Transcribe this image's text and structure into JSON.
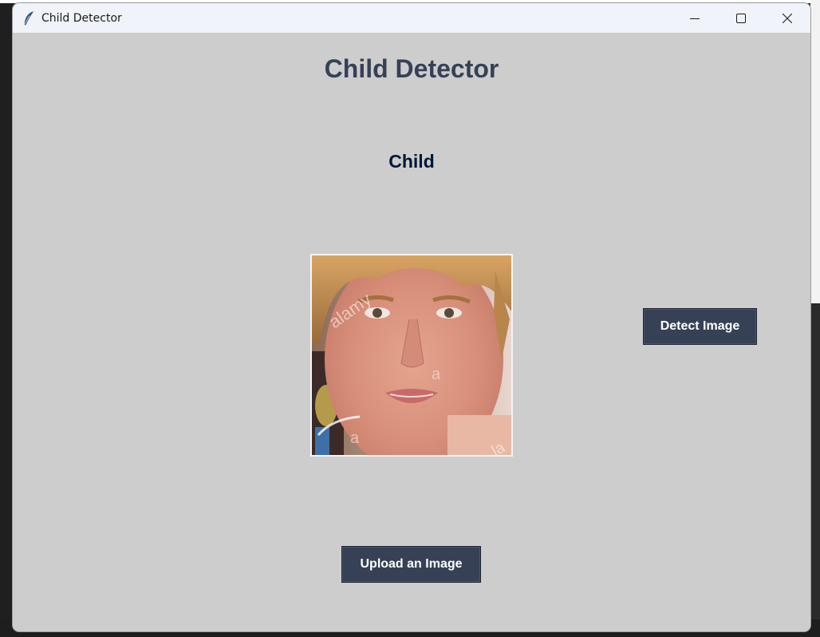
{
  "window": {
    "title": "Child Detector",
    "app_icon": "feather-icon",
    "controls": [
      "minimize-icon",
      "maximize-icon",
      "close-icon"
    ]
  },
  "main": {
    "heading": "Child Detector",
    "result_label": "Child",
    "image_watermark": [
      "alamy",
      "a",
      "a",
      "a",
      "la"
    ],
    "detect_button_label": "Detect Image",
    "upload_button_label": "Upload an Image"
  },
  "colors": {
    "background": "#cdcdcd",
    "heading": "#364156",
    "result_label": "#011638",
    "button_bg": "#364156",
    "button_text": "#ffffff"
  }
}
